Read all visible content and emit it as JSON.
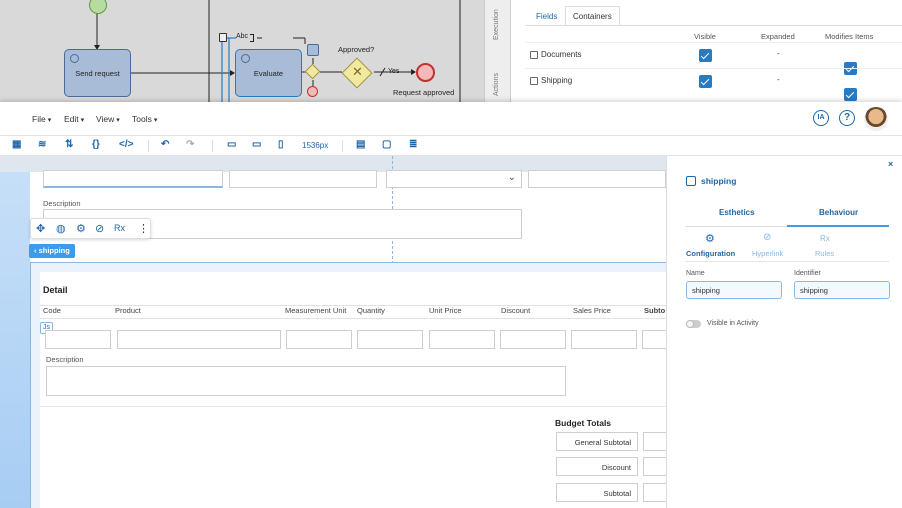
{
  "diagram": {
    "task_send": "Send request",
    "task_evaluate": "Evaluate",
    "annotation": "Abc",
    "gateway_label": "Approved?",
    "flow_yes": "Yes",
    "end_label": "Request approved"
  },
  "back_panel": {
    "vtab_execution": "Execution",
    "vtab_actions": "Actions",
    "tabs": [
      "Fields",
      "Containers"
    ],
    "columns": [
      "Visible",
      "Expanded",
      "Modifies Items"
    ],
    "rows": [
      {
        "name": "Documents",
        "expanded": "-"
      },
      {
        "name": "Shipping",
        "expanded": "-"
      }
    ]
  },
  "menubar": {
    "menus": [
      "File",
      "Edit",
      "View",
      "Tools"
    ],
    "ia_label": "IA"
  },
  "toolbar": {
    "width_label": "1536px"
  },
  "canvas": {
    "description_label_top": "Description",
    "section_chip": "shipping",
    "detail_title": "Detail",
    "columns": [
      "Code",
      "Product",
      "Measurement Unit",
      "Quantity",
      "Unit Price",
      "Discount",
      "Sales Price",
      "Subto"
    ],
    "js_badge": "Js",
    "description_label": "Description",
    "budget_title": "Budget Totals",
    "budget_rows": [
      "General Subtotal",
      "Discount",
      "Subtotal"
    ]
  },
  "right_panel": {
    "title": "shipping",
    "tabs": [
      "Esthetics",
      "Behaviour"
    ],
    "subtabs": [
      "Configuration",
      "Hyperlink",
      "Rules"
    ],
    "name_label": "Name",
    "name_value": "shipping",
    "identifier_label": "Identifier",
    "identifier_value": "shipping",
    "toggle_label": "Visible in Activity"
  },
  "colors": {
    "accent": "#1f66a8",
    "chip": "#3d9be9",
    "check": "#2a7ac0"
  }
}
